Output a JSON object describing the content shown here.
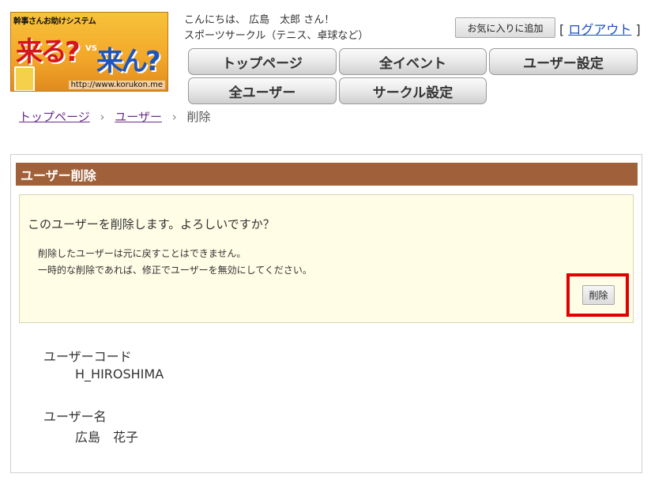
{
  "logo": {
    "tagline": "幹事さんお助けシステム",
    "title_left": "来る?",
    "vs": "VS",
    "title_right": "来ん?",
    "url": "http://www.korukon.me"
  },
  "greeting": {
    "line1": "こんにちは、 広島　太郎 さん！",
    "line2": "スポーツサークル（テニス、卓球など）"
  },
  "header": {
    "favorite_label": "お気に入りに追加",
    "bracket_open": "[",
    "logout_label": "ログアウト",
    "bracket_close": "]"
  },
  "nav": {
    "items": [
      {
        "label": "トップページ"
      },
      {
        "label": "全イベント"
      },
      {
        "label": "ユーザー設定"
      },
      {
        "label": "全ユーザー"
      },
      {
        "label": "サークル設定"
      }
    ]
  },
  "breadcrumb": {
    "items": [
      "トップページ",
      "ユーザー",
      "削除"
    ],
    "separator": "›"
  },
  "panel": {
    "title": "ユーザー削除",
    "question": "このユーザーを削除します。よろしいですか？",
    "note1": "削除したユーザーは元に戻すことはできません。",
    "note2": "一時的な削除であれば、修正でユーザーを無効にしてください。",
    "delete_label": "削除",
    "fields": [
      {
        "label": "ユーザーコード",
        "value": "H_HIROSHIMA"
      },
      {
        "label": "ユーザー名",
        "value": "広島　花子"
      }
    ]
  },
  "colors": {
    "panel_header": "#a0613a",
    "confirm_bg": "#fffde6",
    "highlight": "#e00000",
    "link": "#1a4fc0",
    "visited_link": "#6b2c8a"
  }
}
